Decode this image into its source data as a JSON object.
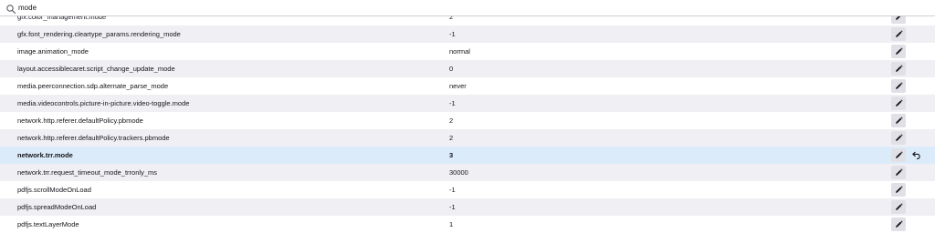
{
  "search": {
    "value": "mode",
    "icon": "search-icon"
  },
  "prefs": [
    {
      "name": "gfx.color_management.mode",
      "value": "2"
    },
    {
      "name": "gfx.font_rendering.cleartype_params.rendering_mode",
      "value": "-1"
    },
    {
      "name": "image.animation_mode",
      "value": "normal"
    },
    {
      "name": "layout.accessiblecaret.script_change_update_mode",
      "value": "0"
    },
    {
      "name": "media.peerconnection.sdp.alternate_parse_mode",
      "value": "never"
    },
    {
      "name": "media.videocontrols.picture-in-picture.video-toggle.mode",
      "value": "-1"
    },
    {
      "name": "network.http.referer.defaultPolicy.pbmode",
      "value": "2"
    },
    {
      "name": "network.http.referer.defaultPolicy.trackers.pbmode",
      "value": "2"
    },
    {
      "name": "network.trr.mode",
      "value": "3",
      "modified": true
    },
    {
      "name": "network.trr.request_timeout_mode_trronly_ms",
      "value": "30000"
    },
    {
      "name": "pdfjs.scrollModeOnLoad",
      "value": "-1"
    },
    {
      "name": "pdfjs.spreadModeOnLoad",
      "value": "-1"
    },
    {
      "name": "pdfjs.textLayerMode",
      "value": "1"
    }
  ],
  "icons": {
    "edit": "pencil-icon",
    "reset": "reset-arrow-icon"
  },
  "colors": {
    "highlight_row": "#dcebfa",
    "alt_row": "#f0f0f4",
    "button_bg": "#e0e0e6"
  }
}
